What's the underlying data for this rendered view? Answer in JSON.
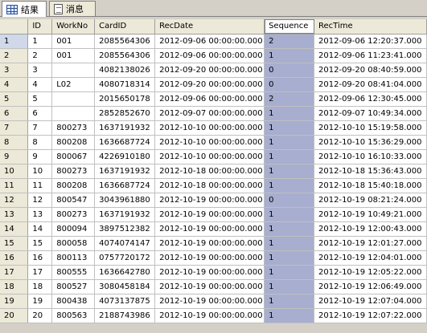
{
  "tabs": [
    {
      "label": "结果",
      "icon": "grid-icon"
    },
    {
      "label": "消息",
      "icon": "message-icon"
    }
  ],
  "columns": [
    "",
    "ID",
    "WorkNo",
    "CardID",
    "RecDate",
    "Sequence",
    "RecTime"
  ],
  "rows": [
    [
      "1",
      "1",
      "001",
      "2085564306",
      "2012-09-06 00:00:00.000",
      "2",
      "2012-09-06 12:20:37.000"
    ],
    [
      "2",
      "2",
      "001",
      "2085564306",
      "2012-09-06 00:00:00.000",
      "1",
      "2012-09-06 11:23:41.000"
    ],
    [
      "3",
      "3",
      "",
      "4082138026",
      "2012-09-20 00:00:00.000",
      "0",
      "2012-09-20 08:40:59.000"
    ],
    [
      "4",
      "4",
      "L02",
      "4080718314",
      "2012-09-20 00:00:00.000",
      "0",
      "2012-09-20 08:41:04.000"
    ],
    [
      "5",
      "5",
      "",
      "2015650178",
      "2012-09-06 00:00:00.000",
      "2",
      "2012-09-06 12:30:45.000"
    ],
    [
      "6",
      "6",
      "",
      "2852852670",
      "2012-09-07 00:00:00.000",
      "1",
      "2012-09-07 10:49:34.000"
    ],
    [
      "7",
      "7",
      "800273",
      "1637191932",
      "2012-10-10 00:00:00.000",
      "1",
      "2012-10-10 15:19:58.000"
    ],
    [
      "8",
      "8",
      "800208",
      "1636687724",
      "2012-10-10 00:00:00.000",
      "1",
      "2012-10-10 15:36:29.000"
    ],
    [
      "9",
      "9",
      "800067",
      "4226910180",
      "2012-10-10 00:00:00.000",
      "1",
      "2012-10-10 16:10:33.000"
    ],
    [
      "10",
      "10",
      "800273",
      "1637191932",
      "2012-10-18 00:00:00.000",
      "1",
      "2012-10-18 15:36:43.000"
    ],
    [
      "11",
      "11",
      "800208",
      "1636687724",
      "2012-10-18 00:00:00.000",
      "1",
      "2012-10-18 15:40:18.000"
    ],
    [
      "12",
      "12",
      "800547",
      "3043961880",
      "2012-10-19 00:00:00.000",
      "0",
      "2012-10-19 08:21:24.000"
    ],
    [
      "13",
      "13",
      "800273",
      "1637191932",
      "2012-10-19 00:00:00.000",
      "1",
      "2012-10-19 10:49:21.000"
    ],
    [
      "14",
      "14",
      "800094",
      "3897512382",
      "2012-10-19 00:00:00.000",
      "1",
      "2012-10-19 12:00:43.000"
    ],
    [
      "15",
      "15",
      "800058",
      "4074074147",
      "2012-10-19 00:00:00.000",
      "1",
      "2012-10-19 12:01:27.000"
    ],
    [
      "16",
      "16",
      "800113",
      "0757720172",
      "2012-10-19 00:00:00.000",
      "1",
      "2012-10-19 12:04:01.000"
    ],
    [
      "17",
      "17",
      "800555",
      "1636642780",
      "2012-10-19 00:00:00.000",
      "1",
      "2012-10-19 12:05:22.000"
    ],
    [
      "18",
      "18",
      "800527",
      "3080458184",
      "2012-10-19 00:00:00.000",
      "1",
      "2012-10-19 12:06:49.000"
    ],
    [
      "19",
      "19",
      "800438",
      "4073137875",
      "2012-10-19 00:00:00.000",
      "1",
      "2012-10-19 12:07:04.000"
    ],
    [
      "20",
      "20",
      "800563",
      "2188743986",
      "2012-10-19 00:00:00.000",
      "1",
      "2012-10-19 12:07:22.000"
    ]
  ]
}
